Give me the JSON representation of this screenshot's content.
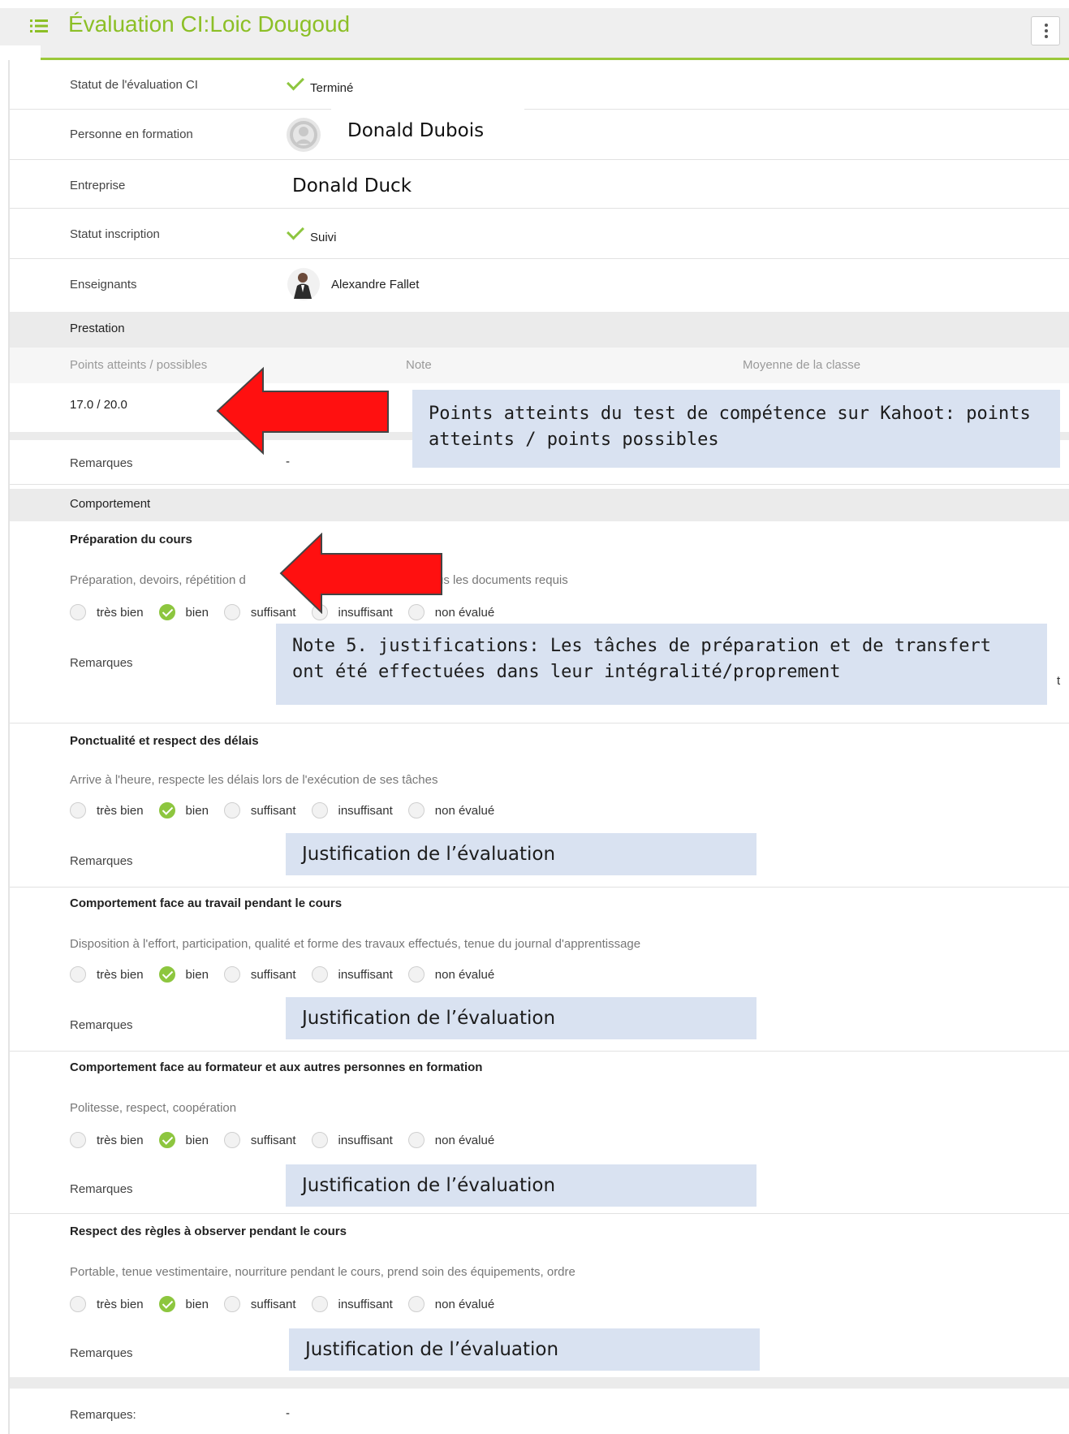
{
  "header": {
    "title": "Évaluation CI:Loic Dougoud",
    "menu_icon": "list-icon",
    "options_icon": "kebab-icon"
  },
  "info": {
    "status_label": "Statut de l'évaluation CI",
    "status_value": "Terminé",
    "trainee_label": "Personne en formation",
    "trainee_name": "Donald Dubois",
    "company_label": "Entreprise",
    "company_name": "Donald Duck",
    "registration_label": "Statut inscription",
    "registration_value": "Suivi",
    "teachers_label": "Enseignants",
    "teacher_name": "Alexandre Fallet"
  },
  "prestation": {
    "heading": "Prestation",
    "col_points": "Points atteints / possibles",
    "col_note": "Note",
    "col_average": "Moyenne de la classe",
    "points_value": "17.0 / 20.0",
    "remarks_label": "Remarques",
    "remarks_value": "-"
  },
  "behaviour": {
    "heading": "Comportement",
    "options": [
      "très bien",
      "bien",
      "suffisant",
      "insuffisant",
      "non évalué"
    ],
    "selected_option": "bien",
    "remarks_label": "Remarques",
    "criteria": [
      {
        "title": "Préparation du cours",
        "desc_left": "Préparation, devoirs, répétition d",
        "desc_right": "us les documents requis",
        "remark": "Note 5. justifications: Les tâches de préparation et de transfert ont été effectuées dans leur intégralité/proprement",
        "edge": "t"
      },
      {
        "title": "Ponctualité et respect des délais",
        "desc": "Arrive à l'heure, respecte les délais lors de l'exécution de ses tâches",
        "remark": "Justification de l’évaluation"
      },
      {
        "title": "Comportement face au travail pendant le cours",
        "desc": "Disposition à l'effort, participation, qualité et forme des travaux effectués, tenue du journal d'apprentissage",
        "remark": "Justification de l’évaluation"
      },
      {
        "title": "Comportement face au formateur et aux autres personnes en formation",
        "desc": "Politesse, respect, coopération",
        "remark": "Justification de l’évaluation"
      },
      {
        "title": "Respect des règles à observer pendant le cours",
        "desc": "Portable, tenue vestimentaire, nourriture pendant le cours, prend soin des équipements, ordre",
        "remark": "Justification de l’évaluation"
      }
    ]
  },
  "annotation": {
    "points_note": "Points atteints du test de compétence sur Kahoot: points atteints / points possibles"
  },
  "footer": {
    "remarks_label": "Remarques:",
    "remarks_value": "-"
  },
  "colors": {
    "accent": "#8cbf26",
    "selected_radio": "#8dc63f",
    "annotation_bg": "#d9e2f1",
    "arrow": "#ff0000"
  }
}
